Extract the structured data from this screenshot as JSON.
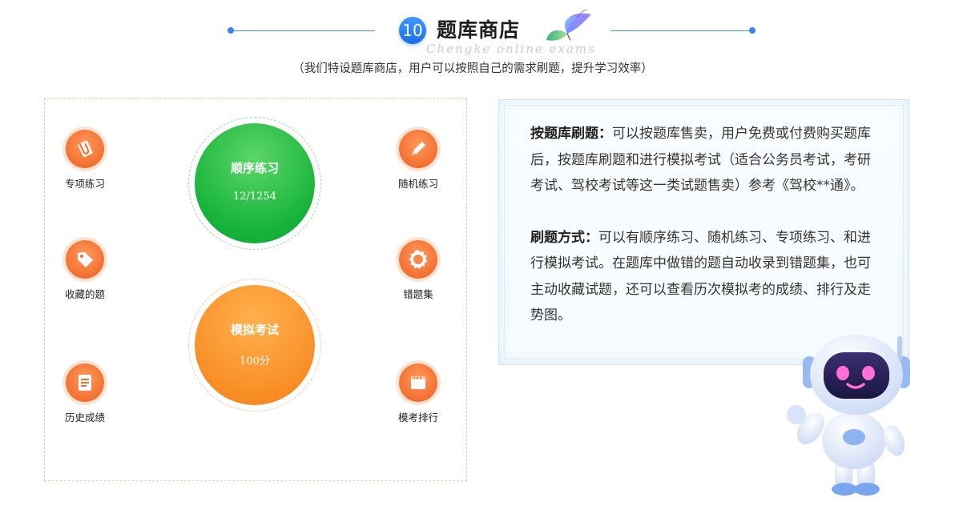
{
  "header": {
    "number": "10",
    "title": "题库商店",
    "subtitle_en": "Chengke online exams",
    "note": "（我们特设题库商店，用户可以按照自己的需求刷题，提升学习效率）"
  },
  "practice": {
    "features": {
      "special": "专项练习",
      "random": "随机练习",
      "favorites": "收藏的题",
      "wrong": "错题集",
      "history": "历史成绩",
      "ranking": "模考排行"
    },
    "sequence": {
      "label": "顺序练习",
      "progress": "12/1254"
    },
    "mock": {
      "label": "模拟考试",
      "score": "100分"
    }
  },
  "info": {
    "para1_key": "按题库刷题：",
    "para1_text": "可以按题库售卖，用户免费或付费购买题库后，按题库刷题和进行模拟考试（适合公务员考试，考研考试、驾校考试等这一类试题售卖）参考《驾校**通》。",
    "para2_key": "刷题方式：",
    "para2_text": "可以有顺序练习、随机练习、专项练习、和进行模拟考试。在题库中做错的题自动收录到错题集，也可主动收藏试题，还可以查看历次模拟考的成绩、排行及走势图。"
  },
  "colors": {
    "accent_blue": "#1a6fe8",
    "feature_orange": "#f26d2e",
    "sequence_green": "#16b33a",
    "mock_orange": "#f98e26"
  }
}
